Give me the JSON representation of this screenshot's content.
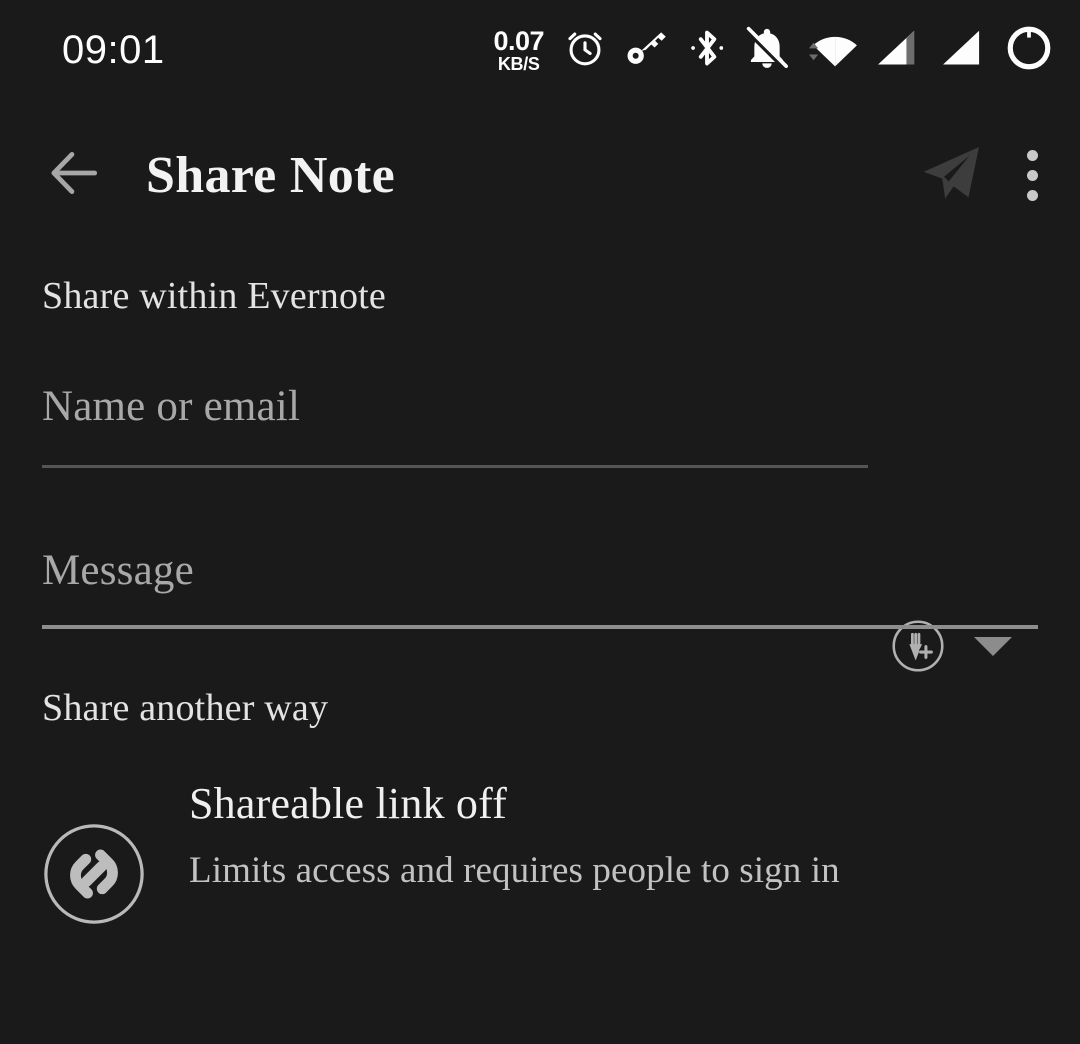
{
  "status_bar": {
    "time": "09:01",
    "network_speed_rate": "0.07",
    "network_speed_unit": "KB/S",
    "icons": [
      "alarm-clock-icon",
      "vpn-key-icon",
      "bluetooth-icon",
      "notifications-silenced-icon",
      "wifi-icon",
      "signal-cellular-1-icon",
      "signal-cellular-2-icon",
      "battery-circle-icon"
    ]
  },
  "app_bar": {
    "back_icon": "arrow-back-icon",
    "title": "Share Note",
    "send_icon": "send-paper-plane-icon",
    "overflow_icon": "more-vertical-icon"
  },
  "share_within": {
    "header": "Share within Evernote",
    "name_field": {
      "placeholder": "Name or email",
      "value": ""
    },
    "add_contact_icon": "add-person-circle-icon",
    "dropdown_icon": "chevron-down-icon",
    "message_field": {
      "placeholder": "Message",
      "value": ""
    }
  },
  "share_another_way": {
    "header": "Share another way",
    "items": [
      {
        "icon": "link-chain-circle-icon",
        "title": "Shareable link off",
        "description": "Limits access and requires people to sign in"
      }
    ]
  },
  "colors": {
    "background": "#1a1a1a",
    "primary_text": "#e8e8e8",
    "secondary_text": "#a8a8a8",
    "divider": "#555555",
    "divider_focused": "#8e8e8e",
    "icon_disabled": "#3d3d3d"
  }
}
